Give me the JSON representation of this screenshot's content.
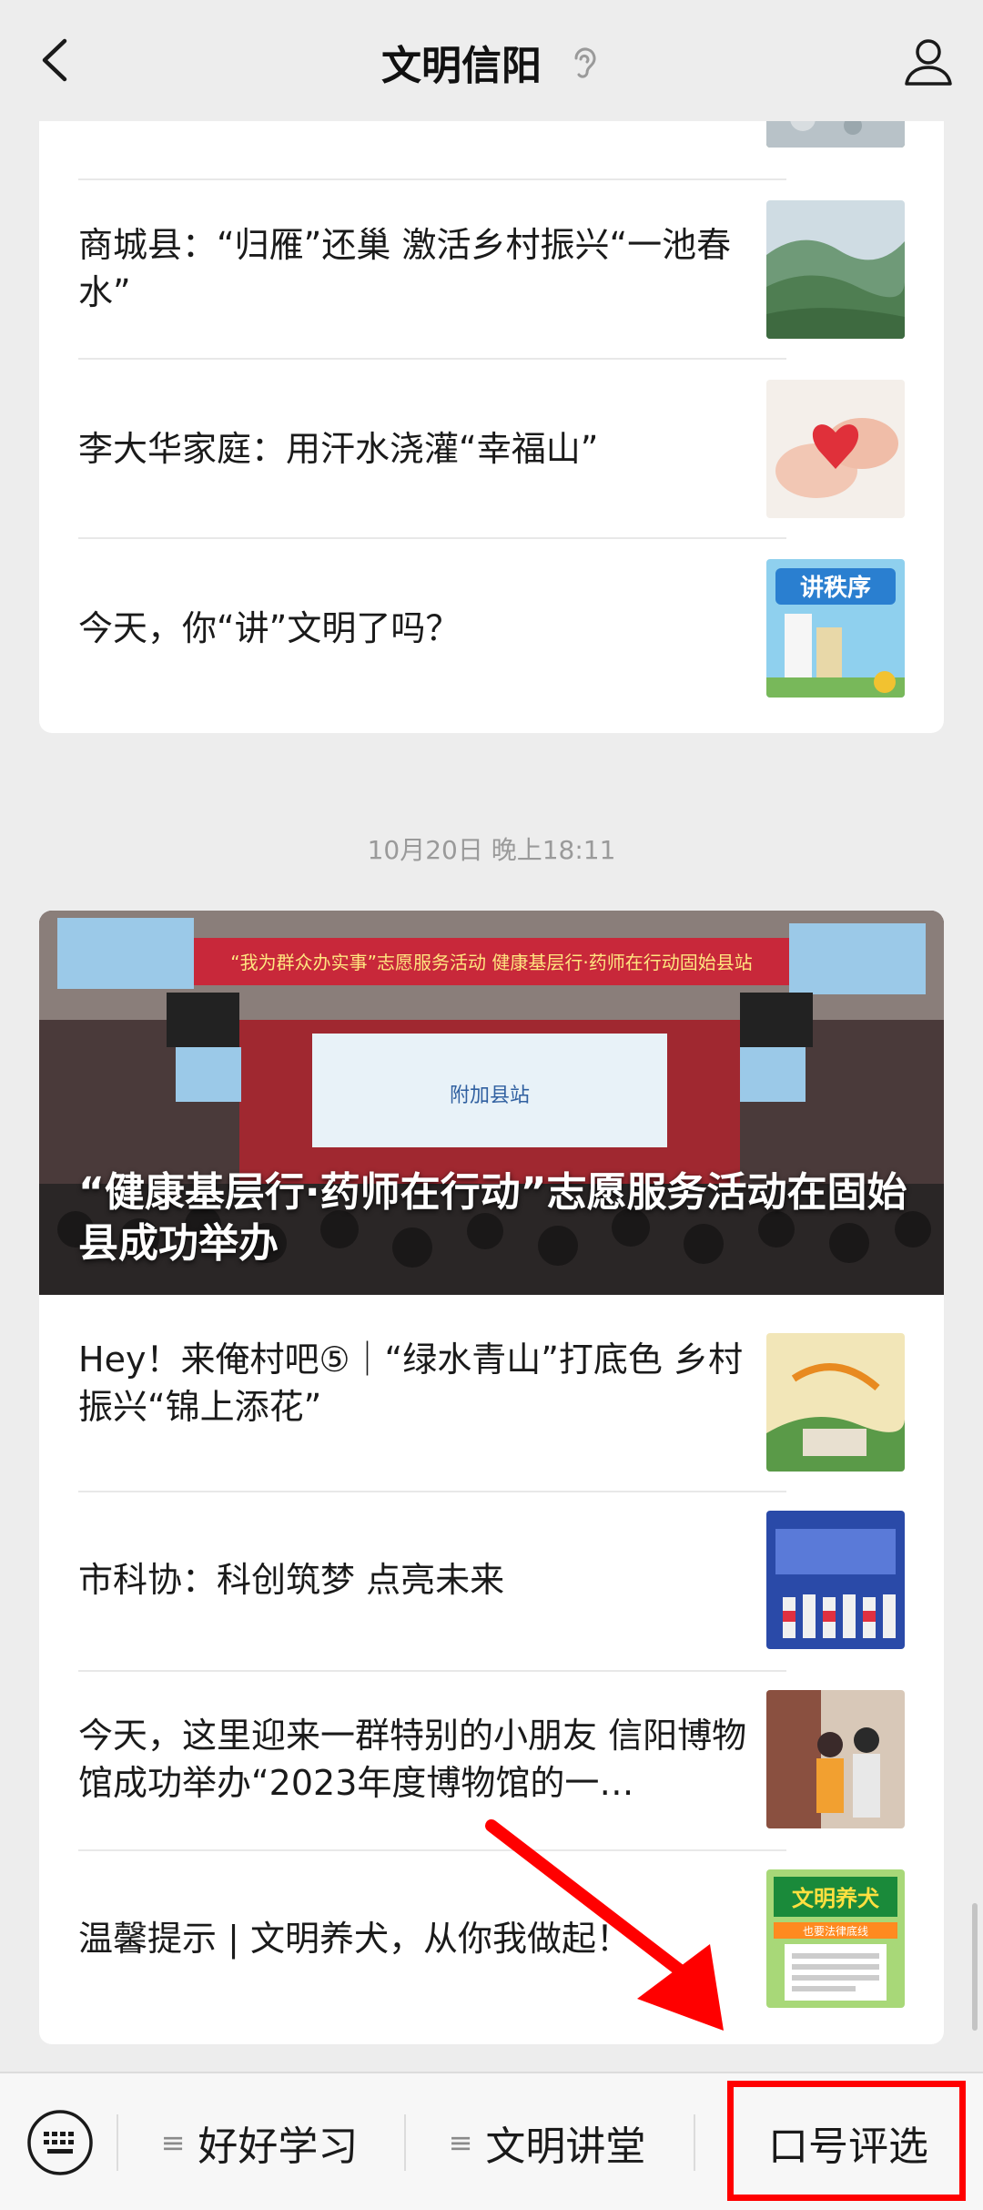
{
  "header": {
    "title": "文明信阳"
  },
  "articles_top": [
    {
      "title": "商城县：“归雁”还巢 激活乡村振兴“一池春水”"
    },
    {
      "title": "李大华家庭：用汗水浇灌“幸福山”"
    },
    {
      "title": "今天，你“讲”文明了吗？"
    }
  ],
  "timestamp": "10月20日 晚上18:11",
  "hero": {
    "caption": "“健康基层行·药师在行动”志愿服务活动在固始县成功举办",
    "banner_text": "“我为群众办实事”志愿服务活动  健康基层行·药师在行动固始县站",
    "screen_text": "附加县站"
  },
  "articles_bottom": [
    {
      "title": "Hey！来俺村吧⑤｜“绿水青山”打底色 乡村振兴“锦上添花”"
    },
    {
      "title": "市科协：科创筑梦 点亮未来"
    },
    {
      "title": "今天，这里迎来一群特别的小朋友 信阳博物馆成功举办“2023年度博物馆的一…"
    },
    {
      "title": "温馨提示 | 文明养犬，从你我做起！"
    }
  ],
  "thumb_text": {
    "order": "讲秩序",
    "dog_title": "文明养犬",
    "dog_sub": "也要法律底线"
  },
  "bottom_menu": {
    "item1": "好好学习",
    "item2": "文明讲堂",
    "item3": "口号评选",
    "menu_glyph": "≡"
  },
  "colors": {
    "highlight": "#ff0000",
    "background": "#ededed"
  }
}
